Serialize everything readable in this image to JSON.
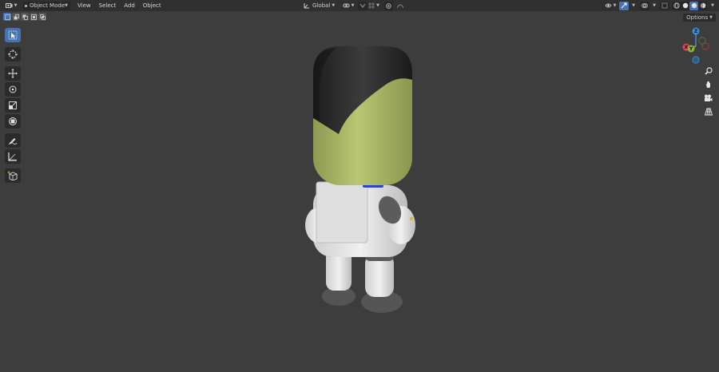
{
  "header": {
    "editor_type_icon": "viewport-icon",
    "mode": "Object Mode",
    "menus": [
      "View",
      "Select",
      "Add",
      "Object"
    ],
    "transform_orientation": "Global"
  },
  "options_label": "Options",
  "gizmo": {
    "z_label": "Z",
    "y_label": "Y",
    "x_label": "X"
  },
  "colors": {
    "accent": "#4772b3",
    "viewport_bg": "#3d3d3d",
    "axis_x": "#e0435a",
    "axis_y": "#7fb833",
    "axis_z": "#3b8fd9",
    "helmet_visor": "#b6c46e"
  },
  "tools": [
    "select-box",
    "cursor",
    "move",
    "rotate",
    "scale",
    "transform",
    "annotate",
    "measure",
    "add-cube"
  ]
}
